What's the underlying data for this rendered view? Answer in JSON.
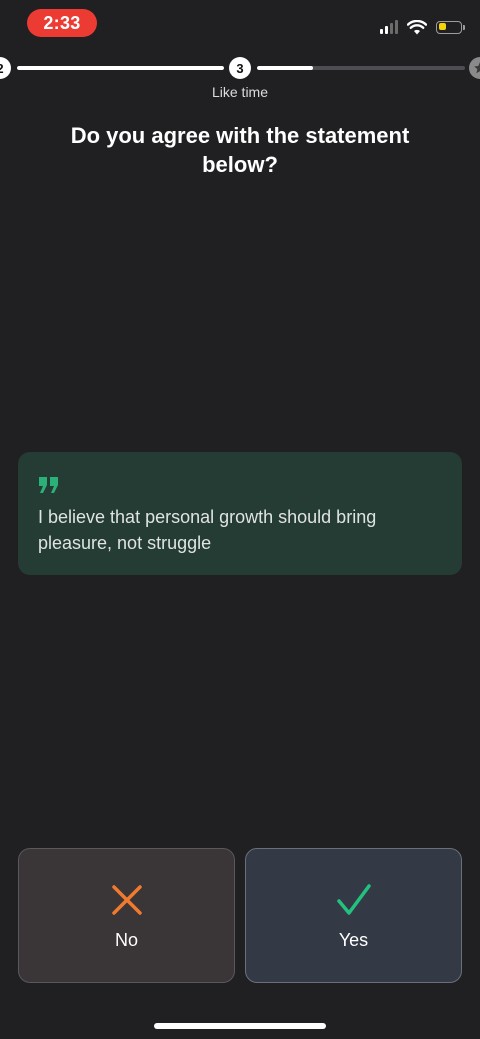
{
  "status_bar": {
    "time": "2:33",
    "battery_level": 0.35,
    "battery_color": "#f5d20b",
    "icons": [
      "signal-icon",
      "wifi-icon",
      "battery-icon"
    ]
  },
  "progress": {
    "previous_step": "2",
    "current_step": "3",
    "current_step_label": "Like time",
    "completed_segment_fill": 1.0,
    "current_segment_fill": 0.27,
    "end_icon": "star-icon"
  },
  "question": {
    "title": "Do you agree with the statement below?"
  },
  "statement": {
    "quote_icon": "quote-icon",
    "text": "I believe that personal growth should bring pleasure, not struggle",
    "accent_color": "#2bb07a"
  },
  "answers": {
    "no": {
      "label": "No",
      "icon": "x-icon",
      "color": "#f07a2e"
    },
    "yes": {
      "label": "Yes",
      "icon": "check-icon",
      "color": "#23c07f"
    }
  }
}
